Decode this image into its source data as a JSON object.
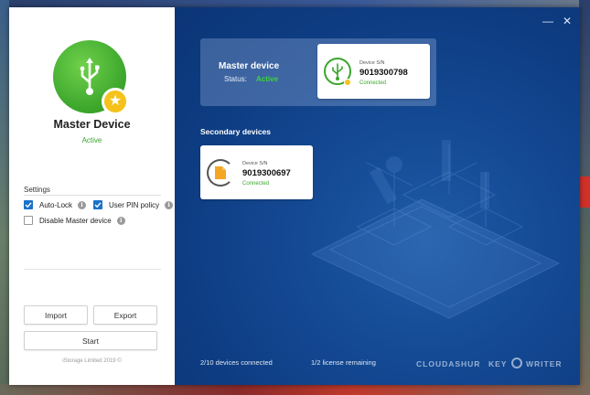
{
  "left": {
    "device_title": "Master Device",
    "device_status": "Active",
    "settings_heading": "Settings",
    "options": [
      {
        "label": "Auto-Lock",
        "checked": true
      },
      {
        "label": "User PIN policy",
        "checked": true
      },
      {
        "label": "Disable Master device",
        "checked": false
      }
    ],
    "buttons": {
      "import": "Import",
      "export": "Export",
      "start": "Start"
    },
    "copyright": "iStorage Limited 2019 ©"
  },
  "right": {
    "window_controls": {
      "minimize": "—",
      "close": "✕"
    },
    "master_card": {
      "title": "Master device",
      "status_label": "Status:",
      "status_value": "Active",
      "device_label": "Device S/N",
      "device_sn": "9019300798",
      "device_state": "Connected"
    },
    "secondary_heading": "Secondary devices",
    "secondary_card": {
      "device_label": "Device S/N",
      "device_sn": "9019300697",
      "device_state": "Connected"
    },
    "footer": {
      "devices_connected": "2/10 devices connected",
      "license_remaining": "1/2 license remaining",
      "brand_left": "CLOUDASHUR",
      "brand_right_a": "KEY",
      "brand_right_b": "WRITER"
    }
  },
  "colors": {
    "accent_blue": "#1b72c9",
    "status_green": "#3aa52b",
    "panel_blue": "#0e3c82",
    "badge_yellow": "#f4c21a",
    "secondary_orange": "#f5a623"
  },
  "icons": {
    "avatar": "usb-icon",
    "badge": "star-icon",
    "master_device": "usb-icon",
    "secondary_device": "file-icon"
  }
}
